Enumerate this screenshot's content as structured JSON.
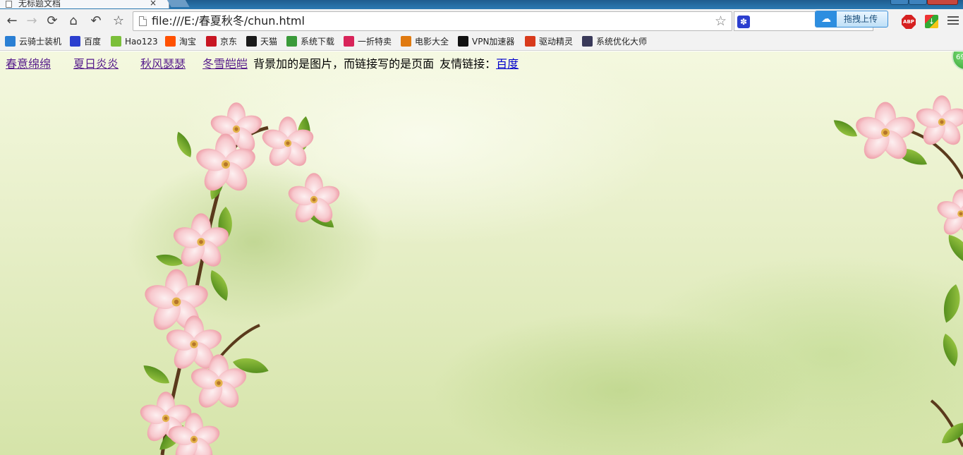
{
  "tab": {
    "title": "无标题文档",
    "close": "×"
  },
  "toolbar": {
    "back": "←",
    "forward": "→",
    "reload": "⟳",
    "home": "⌂",
    "undo": "↶",
    "bookmark": "☆",
    "url": "file:///E:/春夏秋冬/chun.html",
    "url_star": "☆"
  },
  "extensions": {
    "upload_label": "拖拽上传",
    "abp_label": "ABP",
    "badge": "69"
  },
  "bookmarks": [
    {
      "label": "云骑士装机",
      "icon": "cloud-knight-icon",
      "color": "#2a7fd4"
    },
    {
      "label": "百度",
      "icon": "baidu-paw-icon",
      "color": "#2c3fcf"
    },
    {
      "label": "Hao123",
      "icon": "hao123-icon",
      "color": "#7bbf3a"
    },
    {
      "label": "淘宝",
      "icon": "taobao-icon",
      "color": "#ff5000"
    },
    {
      "label": "京东",
      "icon": "jd-icon",
      "color": "#c81623"
    },
    {
      "label": "天猫",
      "icon": "tmall-icon",
      "color": "#1a1a1a"
    },
    {
      "label": "系统下载",
      "icon": "chrome-icon",
      "color": "#3a9a3a"
    },
    {
      "label": "一折特卖",
      "icon": "sale-icon",
      "color": "#d8245a"
    },
    {
      "label": "电影大全",
      "icon": "film-icon",
      "color": "#e07a10"
    },
    {
      "label": "VPN加速器",
      "icon": "vpn-icon",
      "color": "#111111"
    },
    {
      "label": "驱动精灵",
      "icon": "driver-icon",
      "color": "#d83a1c"
    },
    {
      "label": "系统优化大师",
      "icon": "optimizer-icon",
      "color": "#3a3a5a"
    }
  ],
  "page": {
    "links": [
      "春意绵绵",
      "夏日炎炎",
      "秋风瑟瑟",
      "冬雪皑皑"
    ],
    "description": "背景加的是图片，而链接写的是页面",
    "friend_label": "友情链接：",
    "friend_link": "百度"
  },
  "colors": {
    "visited_link": "#551a8b",
    "unvisited_link": "#0000cc",
    "blossom": "#f6c2c8",
    "leaf": "#5a9a1e"
  }
}
